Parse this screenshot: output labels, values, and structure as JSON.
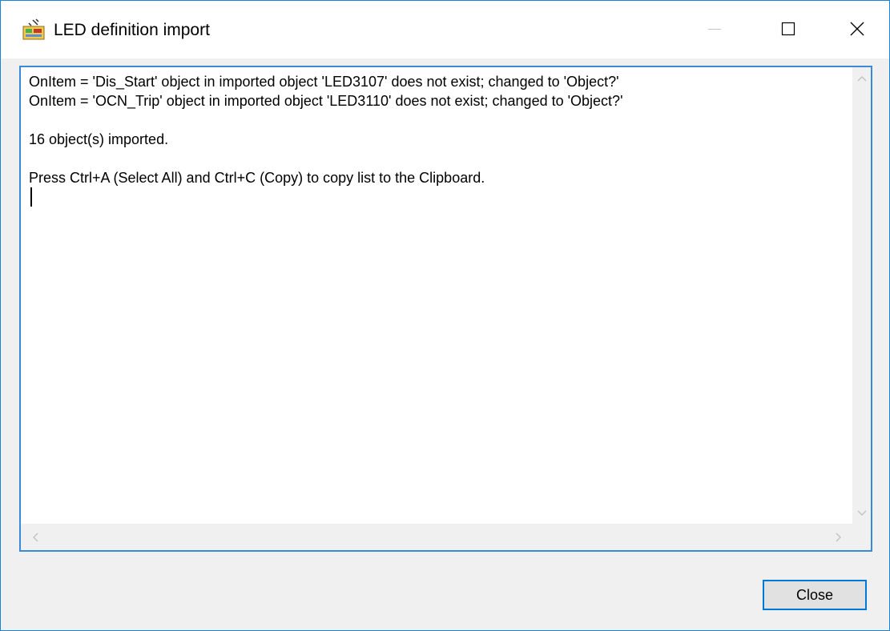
{
  "window": {
    "title": "LED definition import",
    "icon": "led-import-app-icon",
    "controls": {
      "minimize": "minimize-icon",
      "maximize": "maximize-icon",
      "close": "close-icon"
    },
    "border_color": "#1883d7"
  },
  "log": {
    "lines": [
      "OnItem = 'Dis_Start' object in imported object 'LED3107' does not exist; changed to 'Object?'",
      "OnItem = 'OCN_Trip' object in imported object 'LED3110' does not exist; changed to 'Object?'",
      "",
      "16 object(s) imported.",
      "",
      "Press Ctrl+A (Select All) and Ctrl+C (Copy) to copy list to the Clipboard."
    ]
  },
  "footer": {
    "close_label": "Close",
    "accent": "#0078d7"
  }
}
